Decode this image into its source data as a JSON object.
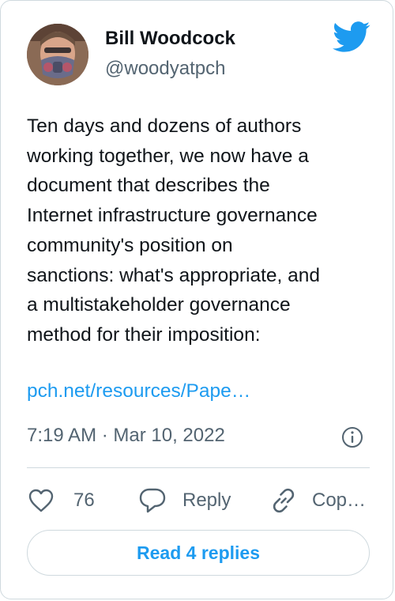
{
  "author": {
    "name": "Bill Woodcock",
    "handle": "@woodyatpch"
  },
  "tweet": {
    "text_lines": [
      "Ten days and dozens of authors",
      "working together, we now have a",
      "document that describes the",
      "Internet infrastructure governance",
      "community's position on",
      "sanctions: what's appropriate, and",
      "a multistakeholder governance",
      "method for their imposition:"
    ],
    "link": "pch.net/resources/Pape…",
    "timestamp": "7:19 AM · Mar 10, 2022"
  },
  "actions": {
    "likes_count": "76",
    "reply_label": "Reply",
    "copy_label": "Cop…"
  },
  "read_replies_label": "Read 4 replies",
  "colors": {
    "accent": "#1d9bf0",
    "text": "#0f1419",
    "muted": "#536471",
    "border": "#cfd9de"
  },
  "icons": [
    "twitter-bird-icon",
    "info-icon",
    "heart-icon",
    "reply-bubble-icon",
    "link-icon"
  ]
}
